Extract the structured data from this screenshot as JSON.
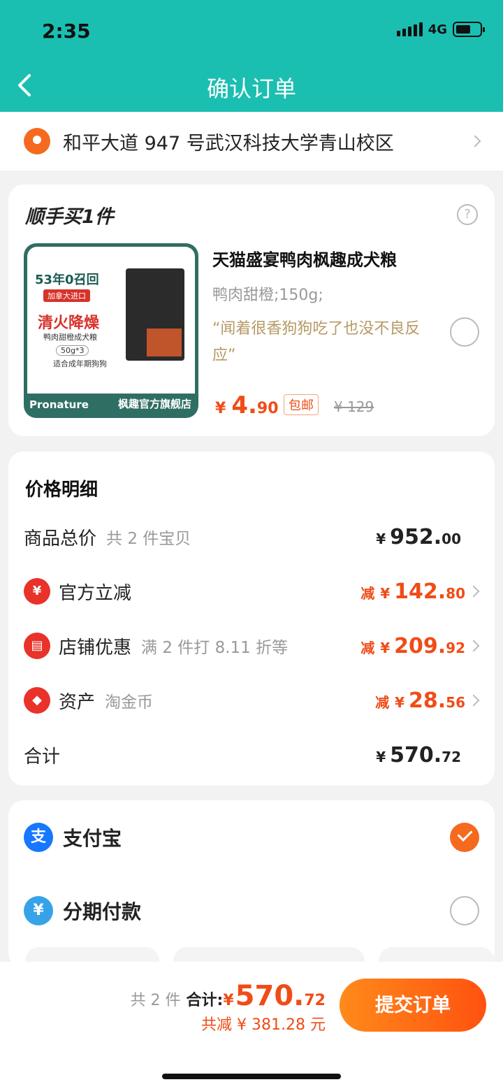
{
  "status_bar": {
    "time": "2:35",
    "network": "4G"
  },
  "header": {
    "title": "确认订单"
  },
  "address": {
    "text": "和平大道 947 号武汉科技大学青山校区"
  },
  "addon": {
    "section_title": "顺手买1件",
    "product": {
      "image": {
        "badge": "53年0召回",
        "flag": "加拿大进口",
        "headline": "清火降燥",
        "subtitle": "鸭肉甜橙成犬粮",
        "size": "50g*3",
        "age": "适合成年期狗狗",
        "brand": "Pronature",
        "store": "枫趣官方旗舰店"
      },
      "name": "天猫盛宴鸭肉枫趣成犬粮",
      "spec": "鸭肉甜橙;150g;",
      "review": "“闻着很香狗狗吃了也没不良反应”",
      "price_currency": "¥",
      "price_int": "4.",
      "price_dec": "90",
      "shipping_badge": "包邮",
      "original_price": "¥ 129",
      "selected": false
    }
  },
  "price_detail": {
    "title": "价格明细",
    "rows": [
      {
        "label": "商品总价",
        "note": "共 2 件宝贝",
        "minus": "",
        "currency": "¥",
        "int": "952.",
        "dec": "00"
      },
      {
        "label": "官方立减",
        "note": "",
        "minus": "减",
        "currency": "¥",
        "int": "142.",
        "dec": "80"
      },
      {
        "label": "店铺优惠",
        "note": "满 2 件打 8.11 折等",
        "minus": "减",
        "currency": "¥",
        "int": "209.",
        "dec": "92"
      },
      {
        "label": "资产",
        "note": "淘金币",
        "minus": "减",
        "currency": "¥",
        "int": "28.",
        "dec": "56"
      },
      {
        "label": "合计",
        "note": "",
        "minus": "",
        "currency": "¥",
        "int": "570.",
        "dec": "72"
      }
    ]
  },
  "payment": {
    "options": [
      {
        "label": "支付宝",
        "icon": "alipay-icon",
        "glyph": "支",
        "selected": true
      },
      {
        "label": "分期付款",
        "icon": "installment-icon",
        "glyph": "¥",
        "selected": false
      }
    ]
  },
  "footer": {
    "count": "共 2 件",
    "total_label": "合计:",
    "total_currency": "¥",
    "total_int": "570.",
    "total_dec": "72",
    "saved": "共减 ¥ 381.28 元",
    "submit_label": "提交订单"
  },
  "colors": {
    "header": "#1bbfb1",
    "accent": "#f04c17",
    "button": "#ff6a14"
  }
}
